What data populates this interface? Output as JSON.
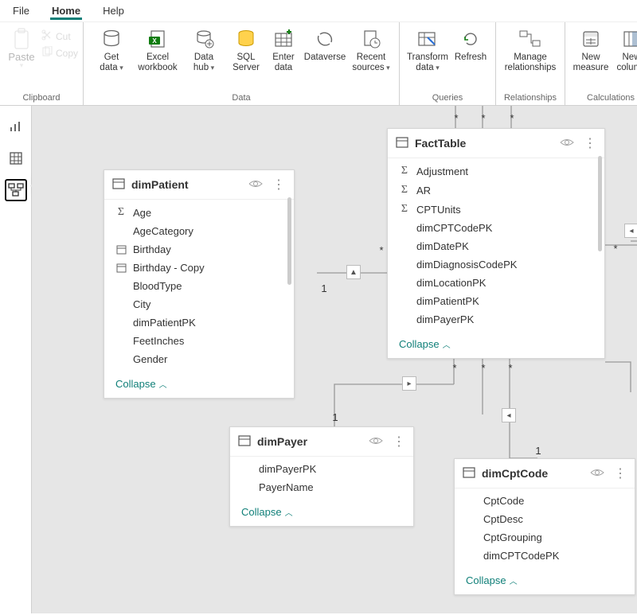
{
  "tabs": {
    "file": "File",
    "home": "Home",
    "help": "Help"
  },
  "ribbon": {
    "clipboard": {
      "paste": "Paste",
      "cut": "Cut",
      "copy": "Copy",
      "group": "Clipboard"
    },
    "data": {
      "get": "Get\ndata",
      "excel": "Excel\nworkbook",
      "hub": "Data\nhub",
      "sql": "SQL\nServer",
      "enter": "Enter\ndata",
      "dv": "Dataverse",
      "recent": "Recent\nsources",
      "group": "Data"
    },
    "queries": {
      "transform": "Transform\ndata",
      "refresh": "Refresh",
      "group": "Queries"
    },
    "rel": {
      "manage": "Manage\nrelationships",
      "group": "Relationships"
    },
    "calc": {
      "measure": "New\nmeasure",
      "column": "New\ncolumn",
      "group": "Calculations"
    }
  },
  "tooltip": "Model",
  "tables": {
    "dimPatient": {
      "title": "dimPatient",
      "fields": [
        {
          "icon": "sigma",
          "label": "Age"
        },
        {
          "icon": "",
          "label": "AgeCategory"
        },
        {
          "icon": "date",
          "label": "Birthday"
        },
        {
          "icon": "date",
          "label": "Birthday - Copy"
        },
        {
          "icon": "",
          "label": "BloodType"
        },
        {
          "icon": "",
          "label": "City"
        },
        {
          "icon": "",
          "label": "dimPatientPK"
        },
        {
          "icon": "",
          "label": "FeetInches"
        },
        {
          "icon": "",
          "label": "Gender"
        }
      ],
      "collapse": "Collapse"
    },
    "factTable": {
      "title": "FactTable",
      "fields": [
        {
          "icon": "sigma",
          "label": "Adjustment"
        },
        {
          "icon": "sigma",
          "label": "AR"
        },
        {
          "icon": "sigma",
          "label": "CPTUnits"
        },
        {
          "icon": "",
          "label": "dimCPTCodePK"
        },
        {
          "icon": "",
          "label": "dimDatePK"
        },
        {
          "icon": "",
          "label": "dimDiagnosisCodePK"
        },
        {
          "icon": "",
          "label": "dimLocationPK"
        },
        {
          "icon": "",
          "label": "dimPatientPK"
        },
        {
          "icon": "",
          "label": "dimPayerPK"
        }
      ],
      "collapse": "Collapse"
    },
    "dimPayer": {
      "title": "dimPayer",
      "fields": [
        {
          "icon": "",
          "label": "dimPayerPK"
        },
        {
          "icon": "",
          "label": "PayerName"
        }
      ],
      "collapse": "Collapse"
    },
    "dimCptCode": {
      "title": "dimCptCode",
      "fields": [
        {
          "icon": "",
          "label": "CptCode"
        },
        {
          "icon": "",
          "label": "CptDesc"
        },
        {
          "icon": "",
          "label": "CptGrouping"
        },
        {
          "icon": "",
          "label": "dimCPTCodePK"
        }
      ],
      "collapse": "Collapse"
    }
  },
  "marks": {
    "one": "1",
    "many": "*"
  }
}
